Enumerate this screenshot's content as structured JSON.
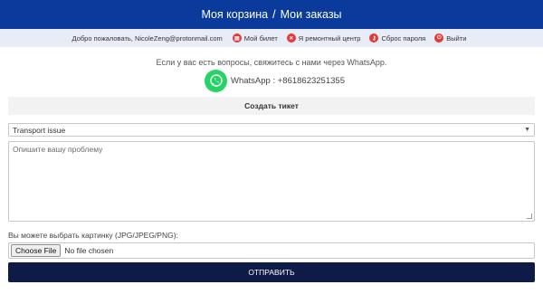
{
  "header": {
    "cart_link": "Моя корзина",
    "separator": "/",
    "orders_link": "Мои заказы"
  },
  "userbar": {
    "welcome": "Добро пожаловать, NicoleZeng@protonmail.com",
    "links": [
      {
        "label": "Мой билет",
        "icon": "ticket-icon"
      },
      {
        "label": "Я ремонтный центр",
        "icon": "wrench-icon"
      },
      {
        "label": "Сброс пароля",
        "icon": "key-icon"
      },
      {
        "label": "Выйти",
        "icon": "logout-icon"
      }
    ],
    "icon_color": "#e53935"
  },
  "help": {
    "text": "Если у вас есть вопросы, свяжитесь с нами через WhatsApp.",
    "whatsapp": "WhatsApp : +8618623251355"
  },
  "ticket_form": {
    "title": "Создать тикет",
    "issue_select": {
      "selected": "Transport issue"
    },
    "description": {
      "placeholder": "Опишите вашу проблему"
    },
    "image_label": "Вы можете выбрать картинку (JPG/JPEG/PNG):",
    "file_button": "Choose File",
    "file_status": "No file chosen",
    "submit_label": "ОТПРАВИТЬ"
  },
  "colors": {
    "header_bg": "#0a3a9c",
    "userbar_bg": "#e8ecf7",
    "submit_bg": "#0d1b46",
    "whatsapp_green": "#25d366"
  }
}
